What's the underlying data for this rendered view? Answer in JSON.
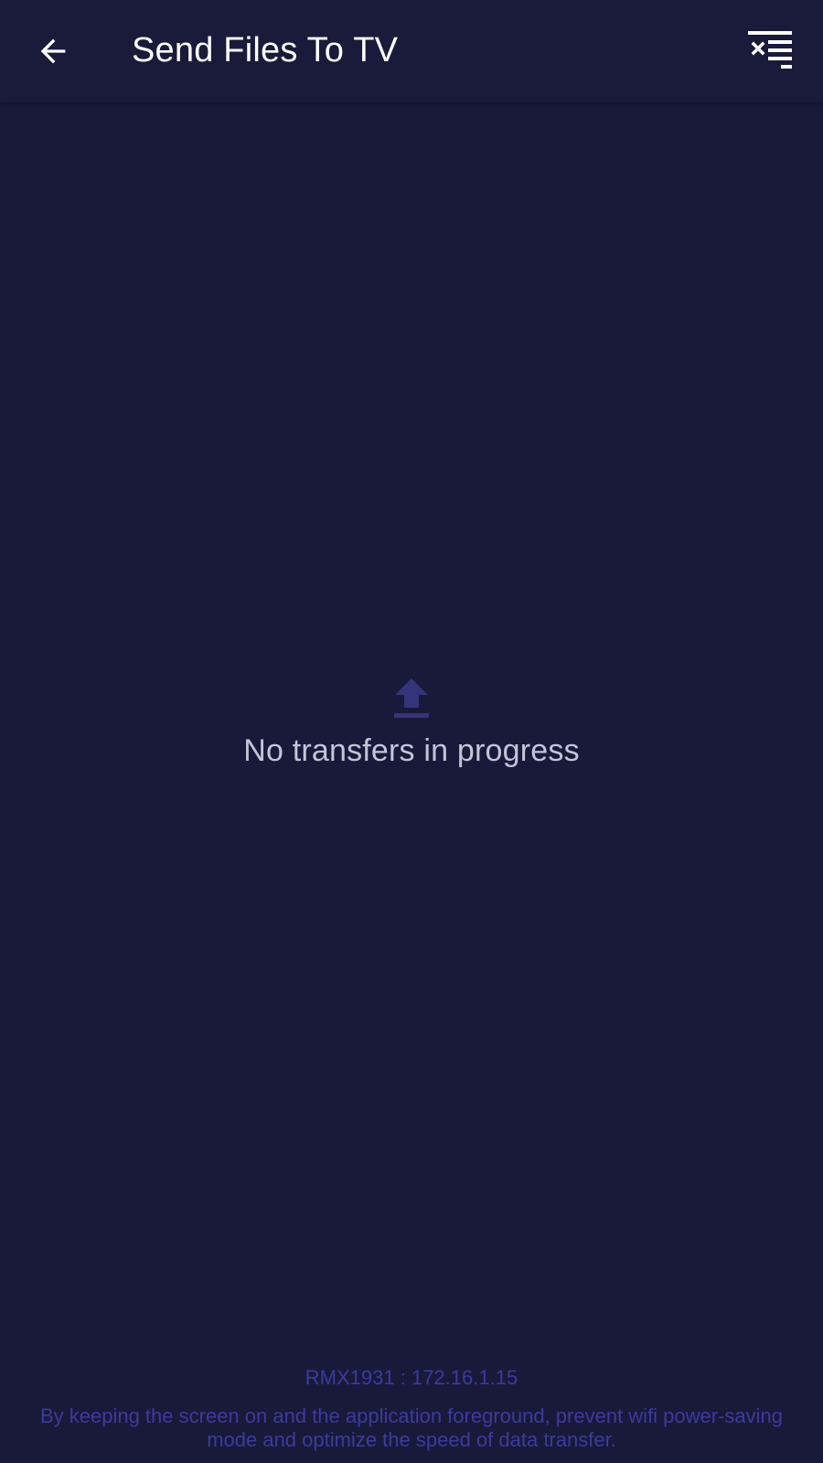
{
  "header": {
    "title": "Send Files To TV",
    "back_icon": "arrow-left-icon",
    "action_icon": "clear-list-icon"
  },
  "empty_state": {
    "icon": "upload-icon",
    "message": "No transfers in progress"
  },
  "footer": {
    "device_info": "RMX1931 : 172.16.1.15",
    "note": "By keeping the screen on and the application foreground, prevent wifi power-saving mode and optimize the speed of data transfer."
  },
  "colors": {
    "background": "#19193a",
    "app_bar": "#1a1a3b",
    "title_text": "#ffffff",
    "empty_icon": "#34347a",
    "empty_text": "#c4c4d6",
    "footer_text": "#3b3b9e"
  }
}
